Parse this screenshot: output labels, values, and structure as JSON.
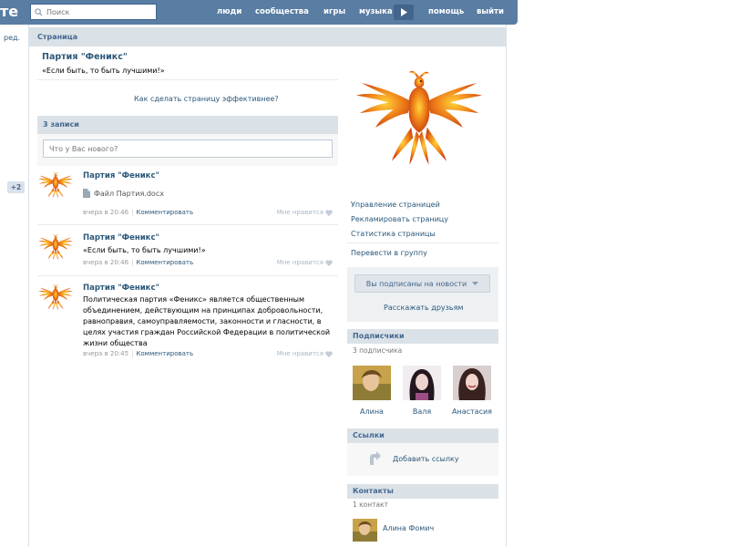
{
  "header": {
    "logo_text": "те",
    "search_placeholder": "Поиск",
    "nav": [
      "люди",
      "сообщества",
      "игры",
      "музыка",
      "помощь",
      "выйти"
    ],
    "bg_color": "#597da3"
  },
  "left": {
    "edit_link": "ред.",
    "badge": "+2"
  },
  "page": {
    "section_title": "Страница",
    "name": "Партия \"Феникс\"",
    "status": "«Если быть, то быть лучшими!»",
    "effective_link": "Как сделать страницу эффективнее?"
  },
  "wall": {
    "count_label": "3 записи",
    "input_placeholder": "Что у Вас нового?",
    "posts": [
      {
        "author": "Партия \"Феникс\"",
        "file": "Файл Партия.docx",
        "time": "вчера в 20:46",
        "comment": "Комментировать",
        "like": "Мне нравится"
      },
      {
        "author": "Партия \"Феникс\"",
        "text": "«Если быть, то быть лучшими!»",
        "time": "вчера в 20:46",
        "comment": "Комментировать",
        "like": "Мне нравится"
      },
      {
        "author": "Партия \"Феникс\"",
        "text": "Политическая партия «Феникс» является общественным объединением, действующим на принципах добровольности, равноправия, самоуправляемости, законности и гласности, в целях участия граждан Российской Федерации в политической жизни общества",
        "time": "вчера в 20:45",
        "comment": "Комментировать",
        "like": "Мне нравится"
      }
    ]
  },
  "right": {
    "manage_links": [
      "Управление страницей",
      "Рекламировать страницу",
      "Статистика страницы"
    ],
    "convert_link": "Перевести в группу",
    "subscribed_button": "Вы подписаны на новости",
    "tell_friends": "Расскажать друзьям",
    "subscribers": {
      "title": "Подписчики",
      "count": "3 подписчика",
      "members": [
        "Алина",
        "Валя",
        "Анастасия"
      ]
    },
    "links": {
      "title": "Ссылки",
      "add_link": "Добавить ссылку"
    },
    "contacts": {
      "title": "Контакты",
      "count": "1 контакт",
      "name": "Алина Фомич"
    }
  },
  "icons": {
    "search": "search-icon",
    "play": "play-icon",
    "file": "document-icon",
    "heart": "heart-icon",
    "dropdown": "chevron-down-icon",
    "add_link": "link-arrow-icon"
  },
  "colors": {
    "link": "#2b587a",
    "accent": "#45688e",
    "bar": "#dae2e8",
    "phoenix": "#e8661a"
  }
}
